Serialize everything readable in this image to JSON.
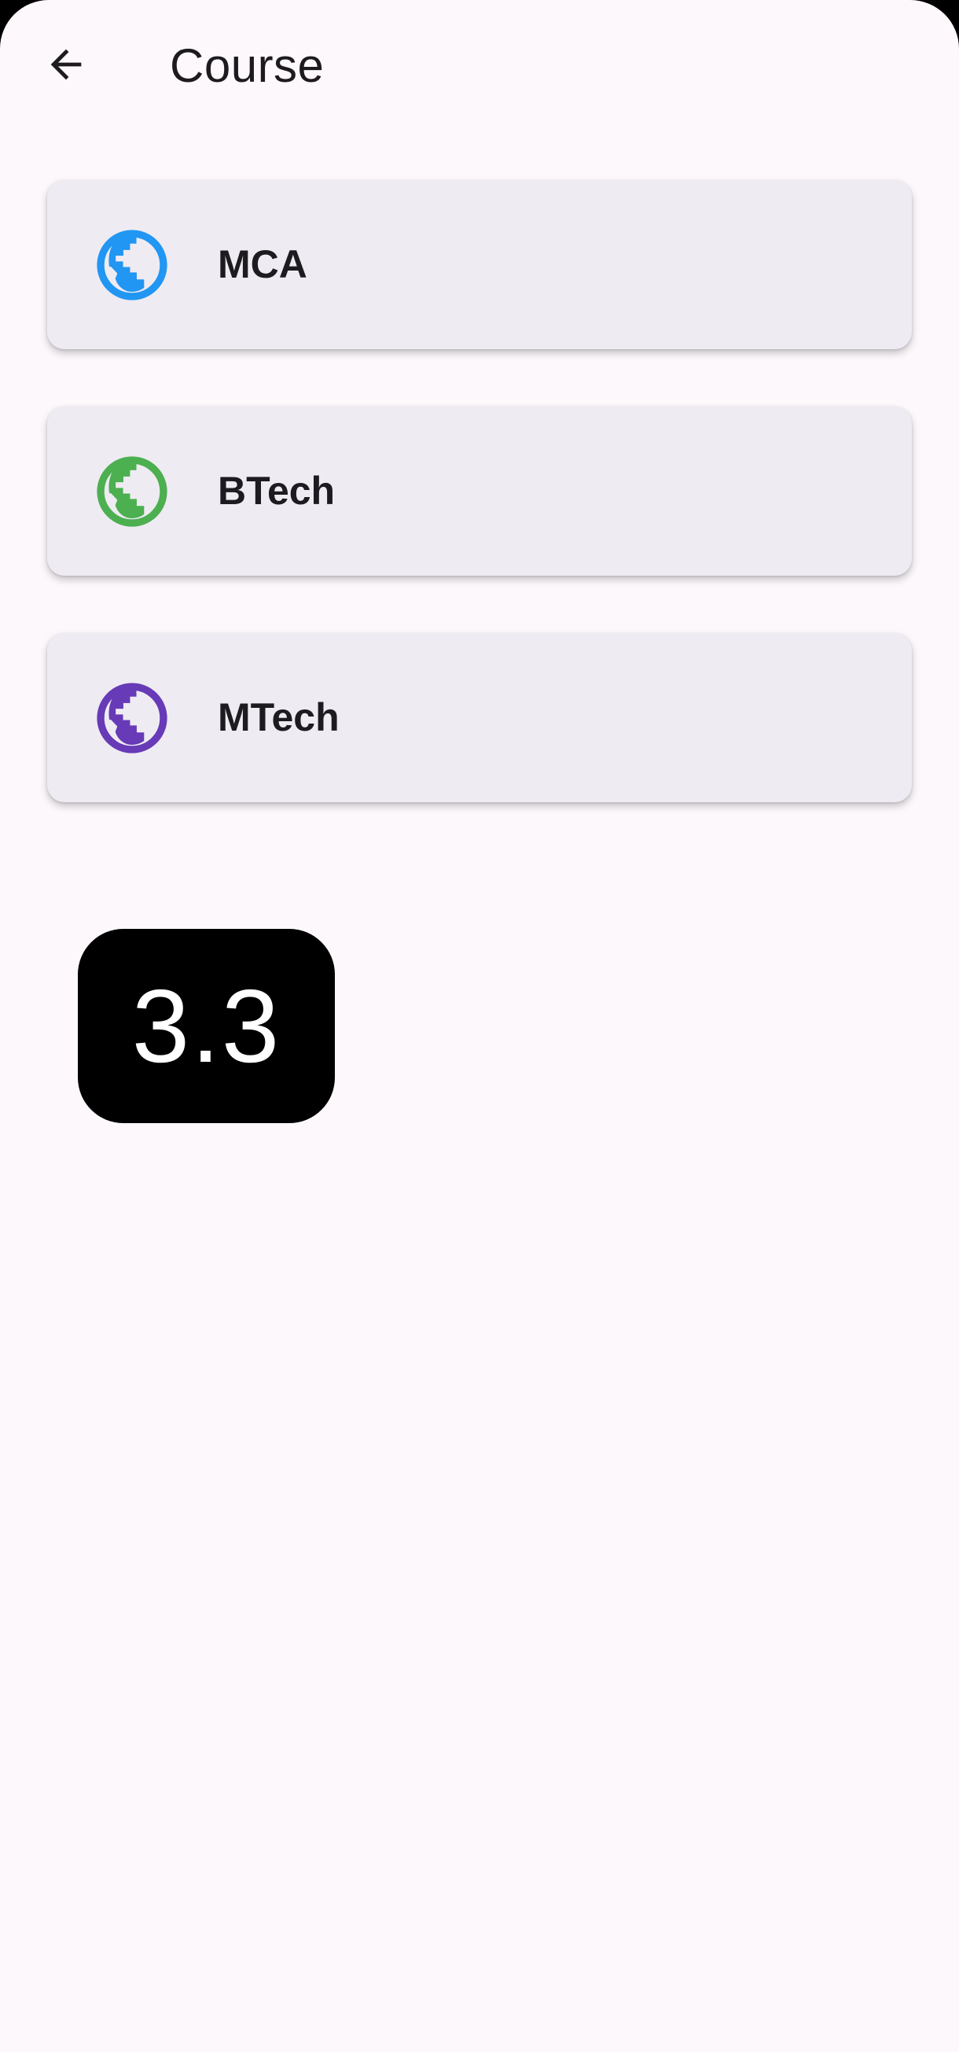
{
  "header": {
    "title": "Course",
    "back_icon": "arrow-back-icon"
  },
  "courses": [
    {
      "label": "MCA",
      "icon": "globe-icon",
      "color": "#2196f3"
    },
    {
      "label": "BTech",
      "icon": "globe-icon",
      "color": "#4caf50"
    },
    {
      "label": "MTech",
      "icon": "globe-icon",
      "color": "#673ab7"
    }
  ],
  "badge": {
    "value": "3.3"
  },
  "colors": {
    "background": "#fdf8fc",
    "card": "#efebf2",
    "text": "#1d1b20"
  }
}
